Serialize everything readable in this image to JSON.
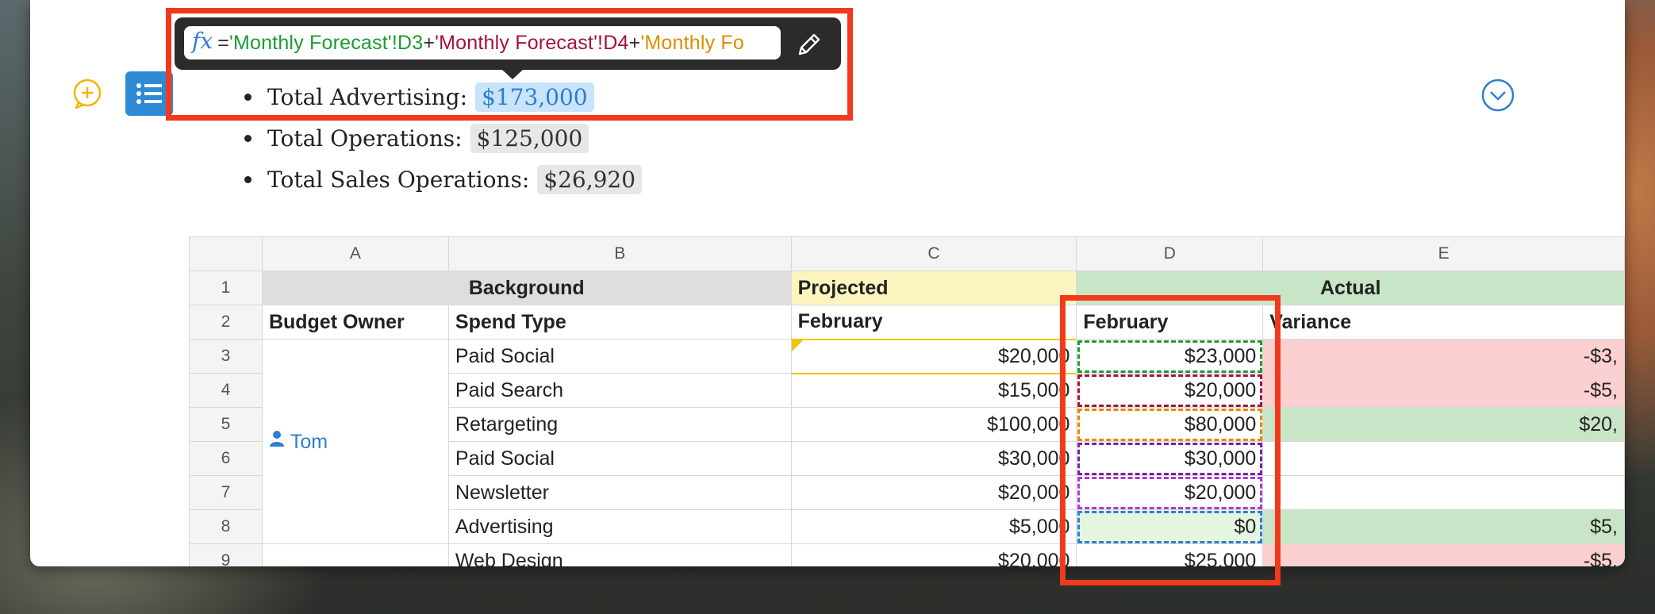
{
  "formula": {
    "icon": "fx-icon",
    "prefix": "=",
    "ref1": "'Monthly Forecast'!D3",
    "plus1": "+",
    "ref2": "'Monthly Forecast'!D4",
    "plus2": "+",
    "ref3": "'Monthly Fo",
    "colors": {
      "ref1": "#1d9a33",
      "ref2": "#a3123d",
      "ref3": "#e08a00"
    }
  },
  "bullets": [
    {
      "label": "Total Advertising:",
      "value": "$173,000"
    },
    {
      "label": "Total Operations:",
      "value": "$125,000"
    },
    {
      "label": "Total Sales Operations:",
      "value": "$26,920"
    }
  ],
  "sheet": {
    "columns": [
      "A",
      "B",
      "C",
      "D",
      "E"
    ],
    "row_numbers": [
      "1",
      "2",
      "3",
      "4",
      "5",
      "6",
      "7",
      "8",
      "9"
    ],
    "row1": {
      "background": "Background",
      "projected": "Projected",
      "actual": "Actual"
    },
    "row2": {
      "owner": "Budget Owner",
      "spend": "Spend Type",
      "c": "February",
      "d": "February",
      "e": "Variance"
    },
    "owner_name": "Tom",
    "rows": [
      {
        "spend": "Paid Social",
        "projected": "$20,000",
        "actual": "$23,000",
        "variance": "-$3,"
      },
      {
        "spend": "Paid Search",
        "projected": "$15,000",
        "actual": "$20,000",
        "variance": "-$5,"
      },
      {
        "spend": "Retargeting",
        "projected": "$100,000",
        "actual": "$80,000",
        "variance": "$20,"
      },
      {
        "spend": "Paid Social",
        "projected": "$30,000",
        "actual": "$30,000",
        "variance": ""
      },
      {
        "spend": "Newsletter",
        "projected": "$20,000",
        "actual": "$20,000",
        "variance": ""
      },
      {
        "spend": "Advertising",
        "projected": "$5,000",
        "actual": "$0",
        "variance": "$5,"
      },
      {
        "spend": "Web Design",
        "projected": "$20,000",
        "actual": "$25,000",
        "variance": "-$5,"
      }
    ]
  },
  "colors": {
    "accent": "#2f8ad6",
    "highlight_box": "#f2391c",
    "projected_header": "#fdf5bf",
    "actual_header": "#c8e6c7",
    "negative": "#fccfd1"
  }
}
